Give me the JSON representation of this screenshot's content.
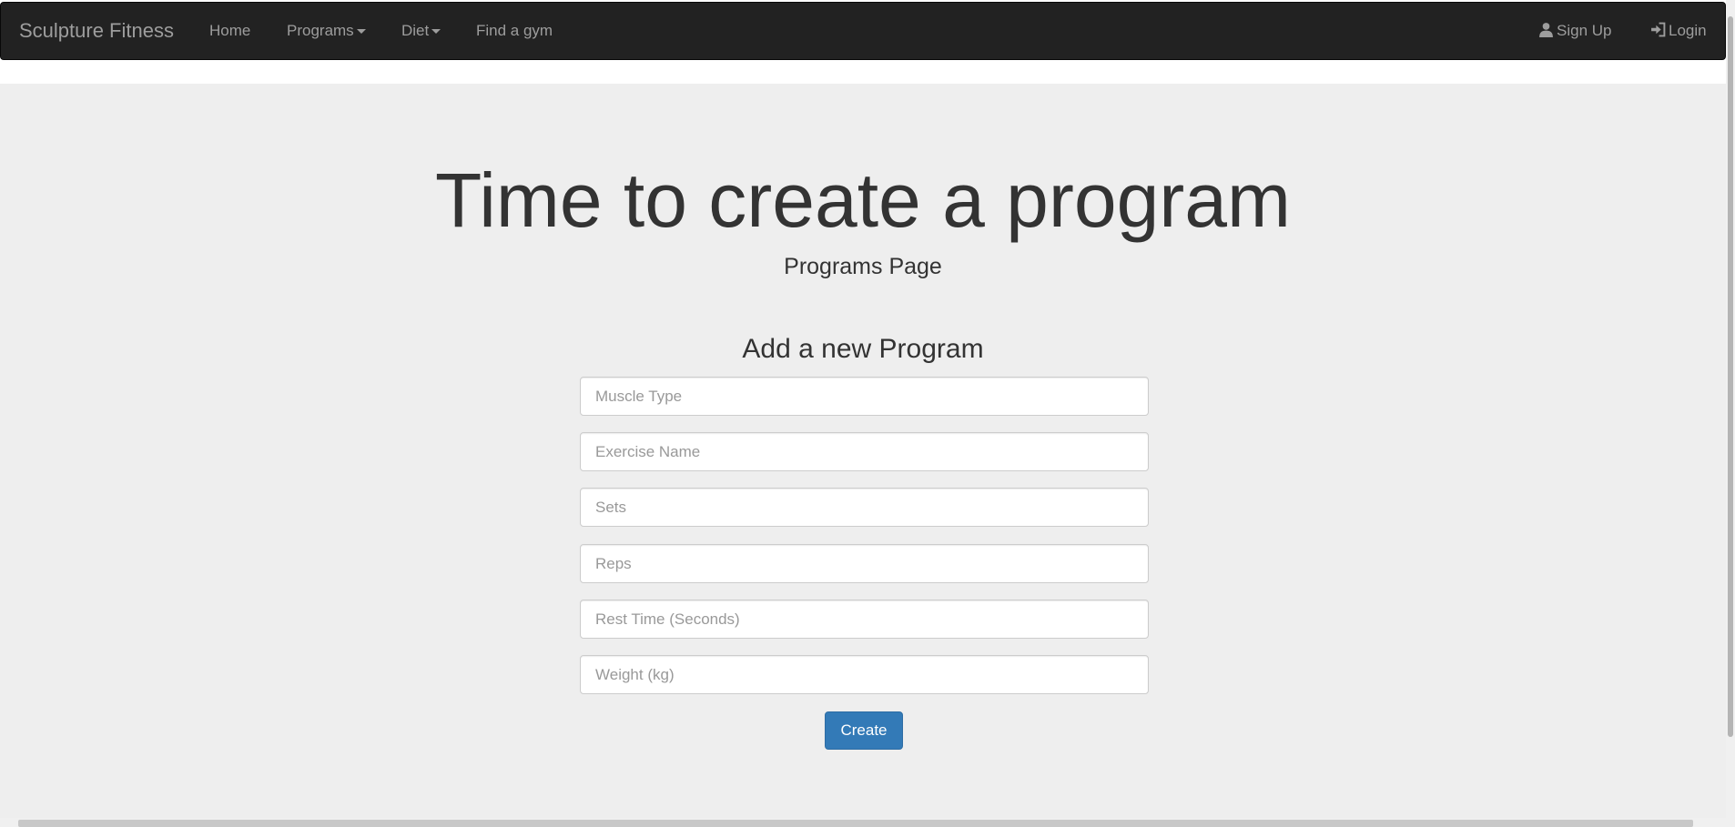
{
  "navbar": {
    "brand": "Sculpture Fitness",
    "items": [
      {
        "label": "Home"
      },
      {
        "label": "Programs"
      },
      {
        "label": "Diet"
      },
      {
        "label": "Find a gym"
      }
    ],
    "right_items": [
      {
        "label": "Sign Up",
        "icon": "user-icon"
      },
      {
        "label": "Login",
        "icon": "login-icon"
      }
    ]
  },
  "hero": {
    "title": "Time to create a program",
    "subtitle": "Programs Page"
  },
  "form": {
    "heading": "Add a new Program",
    "fields": [
      {
        "placeholder": "Muscle Type",
        "value": ""
      },
      {
        "placeholder": "Exercise Name",
        "value": ""
      },
      {
        "placeholder": "Sets",
        "value": ""
      },
      {
        "placeholder": "Reps",
        "value": ""
      },
      {
        "placeholder": "Rest Time (Seconds)",
        "value": ""
      },
      {
        "placeholder": "Weight (kg)",
        "value": ""
      }
    ],
    "submit_label": "Create"
  },
  "colors": {
    "navbar_bg": "#222222",
    "nav_text": "#9d9d9d",
    "jumbotron_bg": "#eeeeee",
    "primary": "#337ab7"
  }
}
